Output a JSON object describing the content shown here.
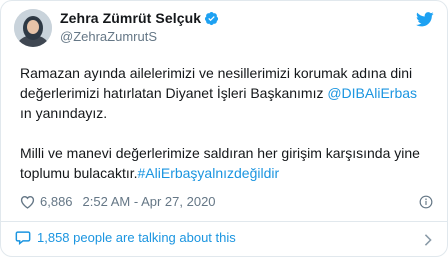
{
  "author": {
    "name": "Zehra Zümrüt Selçuk",
    "handle": "@ZehraZumrutS"
  },
  "tweet": {
    "p1_line1": "Ramazan ayında ailelerimizi ve nesillerimizi korumak adına dini",
    "p1_line2_text": "değerlerimizi hatırlatan Diyanet İşleri Başkanımız ",
    "p1_mention": "@DIBAliErbas",
    "p1_line3": "ın yanındayız.",
    "p2_line1": "Milli ve manevi değerlerimize saldıran her girişim karşısında yine",
    "p2_line2_text": "toplumu bulacaktır.",
    "p2_hashtag": "#AliErbaşyalnızdeğildir"
  },
  "meta": {
    "likes": "6,886",
    "time": "2:52 AM - Apr 27, 2020"
  },
  "footer": {
    "talking": "1,858 people are talking about this"
  },
  "colors": {
    "link": "#1b95e0",
    "muted": "#657786",
    "text": "#14171a",
    "border": "#e1e8ed"
  },
  "icons": [
    "verified-badge-icon",
    "twitter-bird-icon",
    "heart-icon",
    "info-icon",
    "speech-bubble-icon",
    "chevron-right-icon"
  ]
}
